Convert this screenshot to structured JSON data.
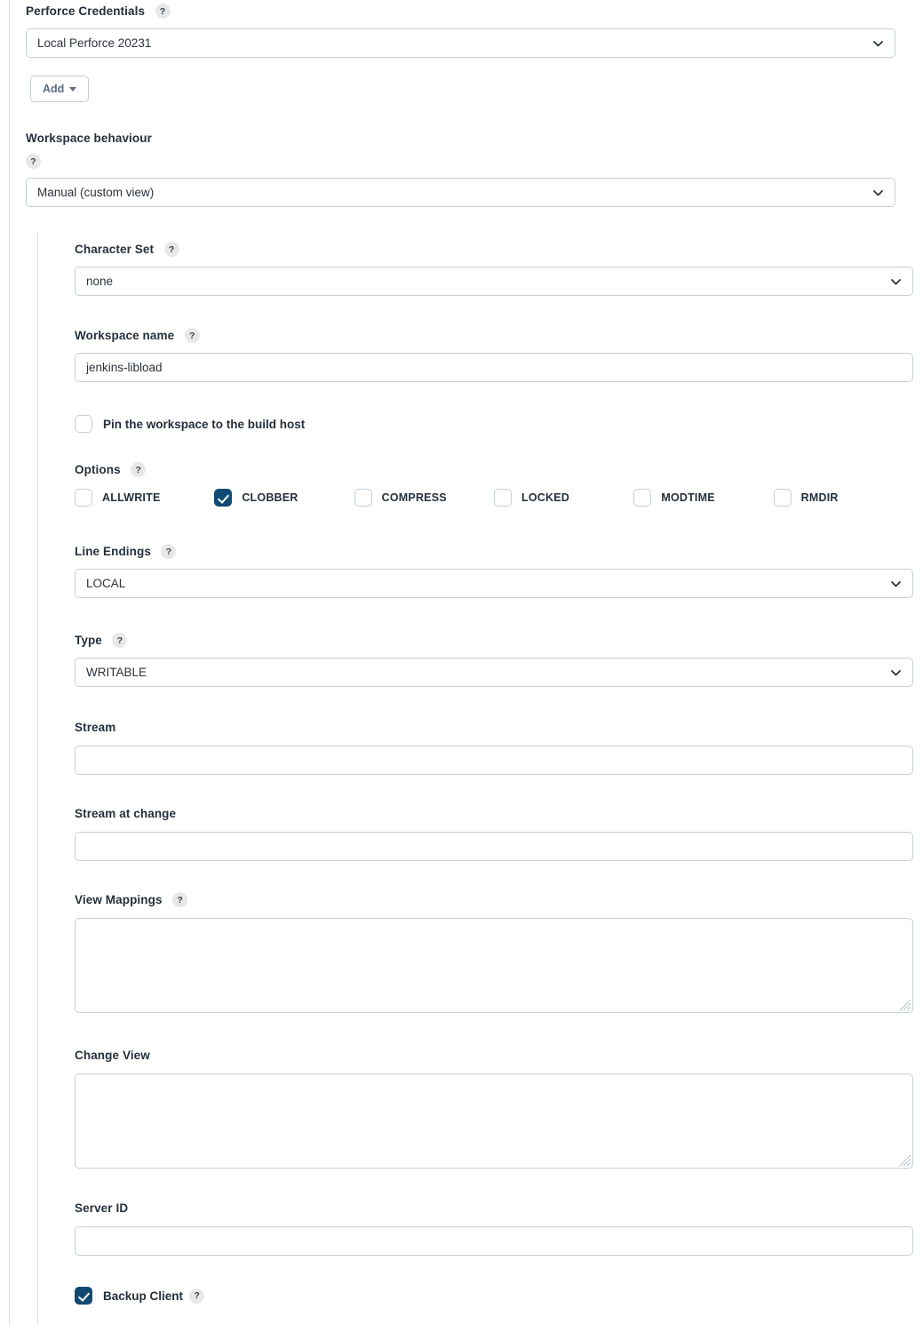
{
  "form": {
    "credentials": {
      "label": "Perforce Credentials",
      "help": "?",
      "value": "Local Perforce 20231",
      "placeholder": "",
      "add_button": "Add"
    },
    "workspace_behaviour": {
      "label": "Workspace behaviour",
      "help": "?",
      "value": "Manual (custom view)"
    },
    "character_set": {
      "label": "Character Set",
      "help": "?",
      "value": "none"
    },
    "workspace_name": {
      "label": "Workspace name",
      "help": "?",
      "value": "jenkins-libload",
      "placeholder": ""
    },
    "pin_workspace": {
      "label": "Pin the workspace to the build host",
      "checked": false
    },
    "options": {
      "label": "Options",
      "help": "?",
      "items": [
        {
          "label": "ALLWRITE",
          "checked": false
        },
        {
          "label": "CLOBBER",
          "checked": true
        },
        {
          "label": "COMPRESS",
          "checked": false
        },
        {
          "label": "LOCKED",
          "checked": false
        },
        {
          "label": "MODTIME",
          "checked": false
        },
        {
          "label": "RMDIR",
          "checked": false
        }
      ]
    },
    "line_endings": {
      "label": "Line Endings",
      "help": "?",
      "value": "LOCAL"
    },
    "type": {
      "label": "Type",
      "help": "?",
      "value": "WRITABLE"
    },
    "stream": {
      "label": "Stream",
      "value": "",
      "placeholder": ""
    },
    "stream_at_change": {
      "label": "Stream at change",
      "value": "",
      "placeholder": ""
    },
    "view_mappings": {
      "label": "View Mappings",
      "help": "?",
      "value": "",
      "placeholder": ""
    },
    "change_view": {
      "label": "Change View",
      "value": "",
      "placeholder": ""
    },
    "server_id": {
      "label": "Server ID",
      "value": "",
      "placeholder": ""
    },
    "backup_client": {
      "label": "Backup Client",
      "help": "?",
      "checked": true
    }
  },
  "colors": {
    "checkbox_checked": "#104a72",
    "border": "#c5d0d9",
    "rule": "#d8dde3",
    "text": "#26303b",
    "button_text": "#5b6b86"
  }
}
